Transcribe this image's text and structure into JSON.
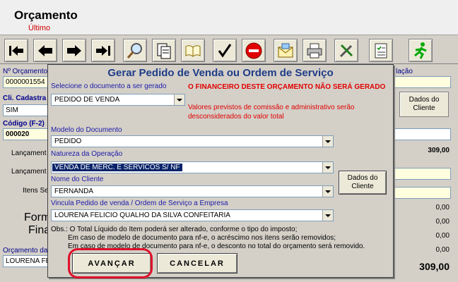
{
  "window": {
    "title": "Orçamento",
    "subtitle": "Último"
  },
  "toolbar": {
    "icons": [
      "first-record-icon",
      "previous-record-icon",
      "next-record-icon",
      "last-record-icon",
      "search-icon",
      "copy-document-icon",
      "open-book-icon",
      "confirm-check-icon",
      "cancel-stop-icon",
      "email-icon",
      "printer-icon",
      "tools-icon",
      "checklist-icon",
      "exit-runner-icon"
    ]
  },
  "background": {
    "n_orcamento_label": "Nº Orçamento",
    "n_orcamento_value": "0000001554",
    "cli_cadastro_label": "Cli. Cadastra",
    "cli_cadastro_value": "SIM",
    "codigo_label": "Código (F-2)",
    "codigo_value": "000020",
    "lancamento1": "Lançament",
    "lancamento2": "Lançament",
    "itens": "Itens Se",
    "forma": "Form",
    "final": "Fina",
    "orcamento_da_label": "Orçamento da",
    "orcamento_da_value": "LOURENA FE",
    "relacao_label": "lação",
    "dados_cliente_btn": "Dados do Cliente",
    "value_309": "309,00",
    "zeros": [
      "0,00",
      "0,00",
      "0,00",
      "0,00"
    ],
    "total": "309,00"
  },
  "dialog": {
    "title": "Gerar Pedido de Venda ou Ordem de Serviço",
    "select_doc_label": "Selecione o documento a ser gerado",
    "select_doc_value": "PEDIDO DE VENDA",
    "warning_financeiro": "O FINANCEIRO DESTE ORÇAMENTO NÃO SERÁ GERADO",
    "warning_valores_1": "Valores previstos de comissão e administrativo serão",
    "warning_valores_2": "desconsiderados do valor total",
    "modelo_label": "Modelo do Documento",
    "modelo_value": "PEDIDO",
    "natureza_label": "Natureza da Operação",
    "natureza_value": "VENDA DE MERC. E SERVICOS S/ NF",
    "cliente_label": "Nome do Cliente",
    "cliente_value": "FERNANDA",
    "dados_cliente_btn": "Dados do Cliente",
    "vincula_label": "Vincula Pedido de venda / Ordem de Serviço a Empresa",
    "vincula_value": "LOURENA FELICIO QUALHO DA SILVA CONFEITARIA",
    "obs_1": "Obs.: O Total Líquido do Item poderá ser alterado, conforme o tipo do imposto;",
    "obs_2": "Em caso de modelo de documento para nf-e, o acréscimo nos itens serão removidos;",
    "obs_3": "Em caso de modelo de documento para nf-e, o desconto no total do orçamento será removido.",
    "avancar_btn": "AVANÇAR",
    "cancelar_btn": "CANCELAR"
  }
}
